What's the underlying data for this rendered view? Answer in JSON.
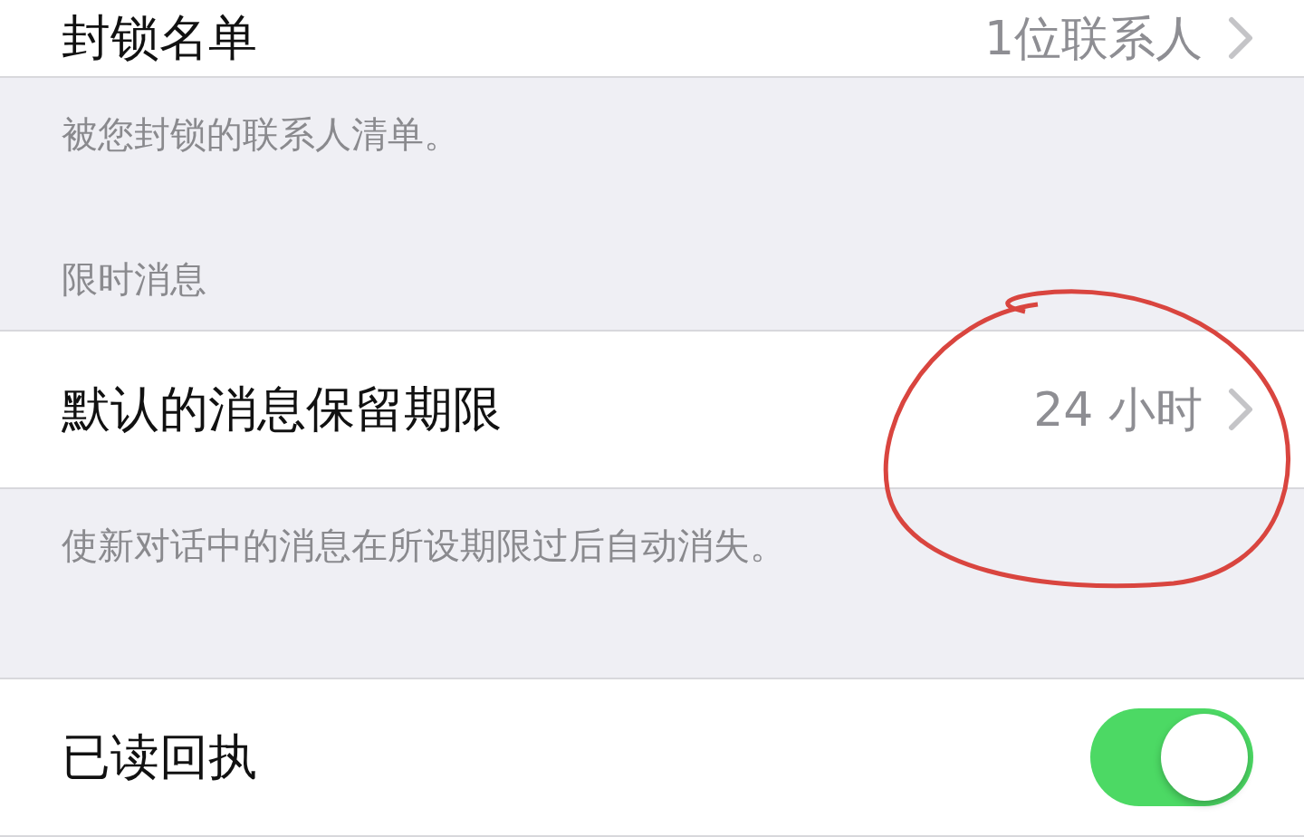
{
  "sections": [
    {
      "rows": [
        {
          "kind": "link",
          "label": "封锁名单",
          "value": "1位联系人"
        }
      ],
      "footer": "被您封锁的联系人清单。"
    },
    {
      "header": "限时消息",
      "rows": [
        {
          "kind": "link",
          "label": "默认的消息保留期限",
          "value": "24 小时",
          "circled": true
        }
      ],
      "footer": "使新对话中的消息在所设期限过后自动消失。"
    },
    {
      "rows": [
        {
          "kind": "toggle",
          "label": "已读回执",
          "on": true
        }
      ]
    }
  ]
}
